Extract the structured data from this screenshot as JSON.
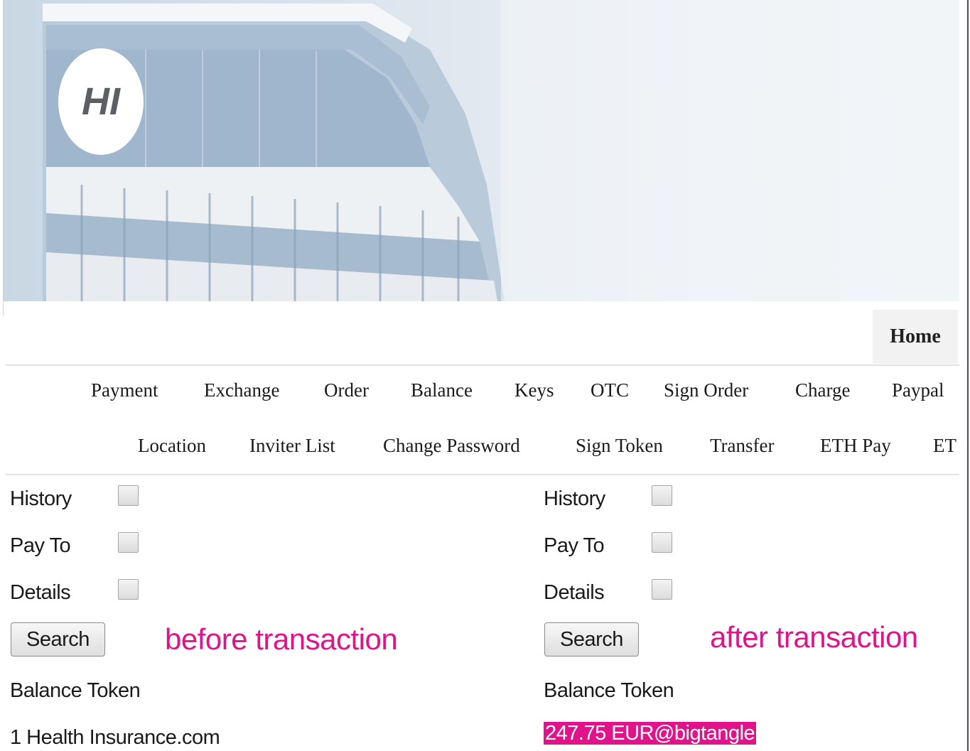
{
  "banner": {
    "logo_text": "HI"
  },
  "header": {
    "home_tab": "Home"
  },
  "nav": {
    "row1": [
      "Payment",
      "Exchange",
      "Order",
      "Balance",
      "Keys",
      "OTC",
      "Sign Order",
      "Charge",
      "Paypal"
    ],
    "row2": [
      "Location",
      "Inviter List",
      "Change Password",
      "Sign Token",
      "Transfer",
      "ETH Pay",
      "ET"
    ]
  },
  "panels": [
    {
      "labels": {
        "history": "History",
        "pay_to": "Pay To",
        "details": "Details"
      },
      "search_label": "Search",
      "annotation": "before transaction",
      "balance_header": "Balance Token",
      "balance_line": "1 Health Insurance.com"
    },
    {
      "labels": {
        "history": "History",
        "pay_to": "Pay To",
        "details": "Details"
      },
      "search_label": "Search",
      "annotation": "after transaction",
      "balance_header": "Balance Token",
      "balance_line": "247.75 EUR@bigtangle"
    }
  ],
  "colors": {
    "annotation": "#e1128a",
    "highlight_bg": "#e1128a"
  }
}
